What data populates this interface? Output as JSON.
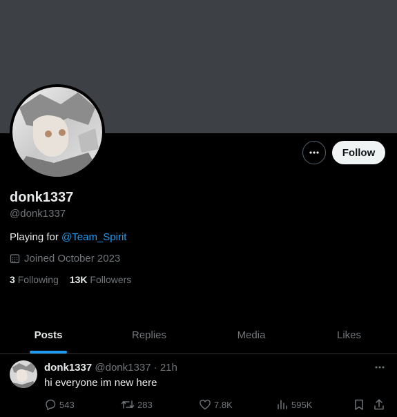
{
  "profile": {
    "display_name": "donk1337",
    "handle": "@donk1337",
    "bio_prefix": "Playing for ",
    "bio_mention": "@Team_Spirit",
    "joined": "Joined October 2023",
    "following_count": "3",
    "following_label": "Following",
    "followers_count": "13K",
    "followers_label": "Followers",
    "follow_button_label": "Follow"
  },
  "tabs": [
    {
      "label": "Posts",
      "active": true
    },
    {
      "label": "Replies",
      "active": false
    },
    {
      "label": "Media",
      "active": false
    },
    {
      "label": "Likes",
      "active": false
    }
  ],
  "post": {
    "author_name": "donk1337",
    "author_handle": "@donk1337",
    "separator": "·",
    "time": "21h",
    "text": "hi everyone im new here",
    "replies": "543",
    "reposts": "283",
    "likes": "7.8K",
    "views": "595K"
  },
  "colors": {
    "background": "#000000",
    "banner": "#3d4146",
    "accent": "#1d9bf0",
    "muted_text": "#71767b"
  },
  "icons": [
    "more-icon",
    "calendar-icon",
    "reply-icon",
    "repost-icon",
    "like-icon",
    "views-icon",
    "bookmark-icon",
    "share-icon"
  ]
}
